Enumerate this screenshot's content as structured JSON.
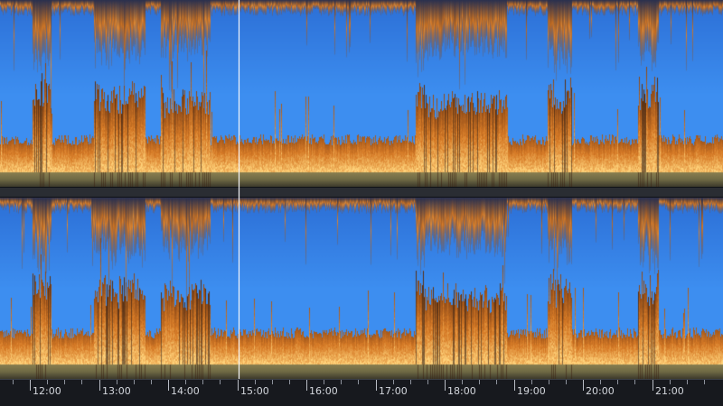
{
  "view": {
    "type": "spectral-frequency-display",
    "channels": [
      "left",
      "right"
    ],
    "playhead_time": "14:58"
  },
  "colors": {
    "background_band": "#3d8ef0",
    "background_band_top": "#2c6fd6",
    "energy_low": "#7a3d14",
    "energy_mid": "#d67a26",
    "energy_high": "#ffd27a",
    "floor_band": "#6f6a45",
    "divider": "#2a2d33",
    "playhead": "#f4f6fb",
    "ruler_background": "#17191e",
    "ruler_text": "#d4d7dd"
  },
  "timeline": {
    "labels": [
      "12:00",
      "13:00",
      "14:00",
      "15:00",
      "16:00",
      "17:00",
      "18:00",
      "19:00",
      "20:00",
      "21:00"
    ],
    "minor_ticks_per_interval": 4
  },
  "icons": []
}
